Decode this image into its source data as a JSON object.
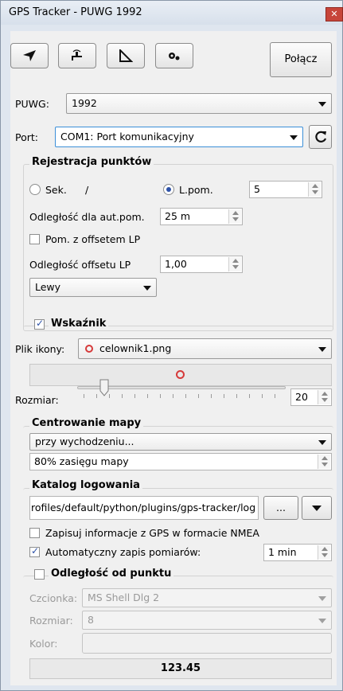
{
  "window": {
    "title": "GPS Tracker - PUWG 1992",
    "close_glyph": "✕"
  },
  "toolbar": {
    "connect_label": "Połącz"
  },
  "puwg": {
    "label": "PUWG:",
    "value": "1992"
  },
  "port": {
    "label": "Port:",
    "value": "COM1: Port komunikacyjny"
  },
  "rejestracja": {
    "title": "Rejestracja punktów",
    "sek_label": "Sek.",
    "slash": "/",
    "lpom_label": "L.pom.",
    "lpom_value": "5",
    "odleglosc_label": "Odległość dla aut.pom.",
    "odleglosc_value": "25 m",
    "offset_cb_label": "Pom. z offsetem LP",
    "offset_label": "Odległość offsetu LP",
    "offset_value": "1,00",
    "side_value": "Lewy"
  },
  "wskaznik": {
    "title": "Wskaźnik",
    "plik_label": "Plik ikony:",
    "plik_value": "celownik1.png",
    "rozmiar_label": "Rozmiar:",
    "rozmiar_value": "20"
  },
  "centrowanie": {
    "title": "Centrowanie mapy",
    "mode_value": "przy wychodzeniu...",
    "range_value": "80% zasięgu mapy"
  },
  "katalog": {
    "title": "Katalog logowania",
    "path": "rofiles/default/python/plugins/gps-tracker/log",
    "browse_label": "...",
    "nmea_label": "Zapisuj informacje z GPS w formacie NMEA",
    "auto_label": "Automatyczny zapis pomiarów:",
    "auto_value": "1 min"
  },
  "odleglosc": {
    "title": "Odległość od punktu",
    "czcionka_label": "Czcionka:",
    "czcionka_value": "MS Shell Dlg 2",
    "rozmiar_label": "Rozmiar:",
    "rozmiar_value": "8",
    "kolor_label": "Kolor:",
    "readout": "123.45"
  }
}
